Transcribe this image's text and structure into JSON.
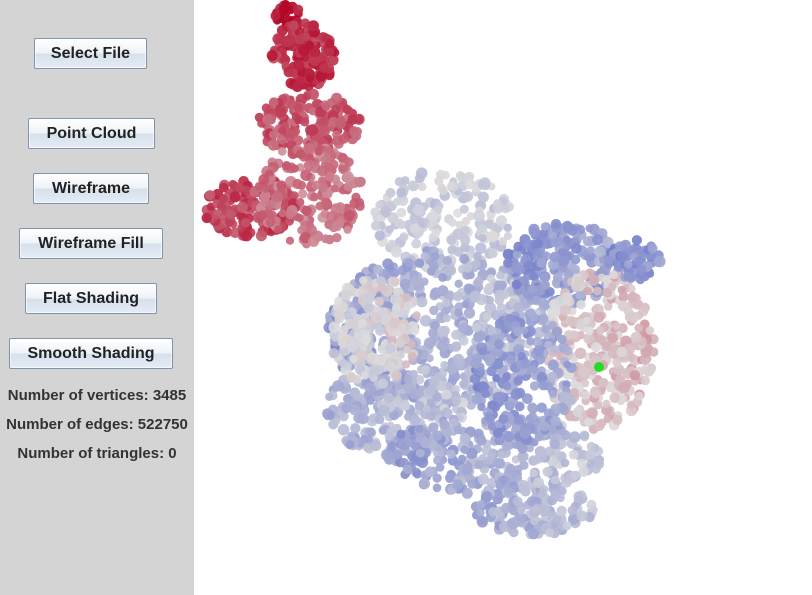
{
  "sidebar": {
    "buttons": {
      "select_file": "Select File",
      "point_cloud": "Point Cloud",
      "wireframe": "Wireframe",
      "wireframe_fill": "Wireframe Fill",
      "flat_shading": "Flat Shading",
      "smooth_shading": "Smooth Shading"
    },
    "stats": {
      "vertices": "Number of vertices: 3485",
      "edges": "Number of edges: 522750",
      "triangles": "Number of triangles: 0"
    }
  },
  "viewport": {
    "background": "#ffffff",
    "colormap": [
      "#3b4cc0",
      "#dddddd",
      "#b40426"
    ],
    "marker_color": "#22dd22"
  }
}
